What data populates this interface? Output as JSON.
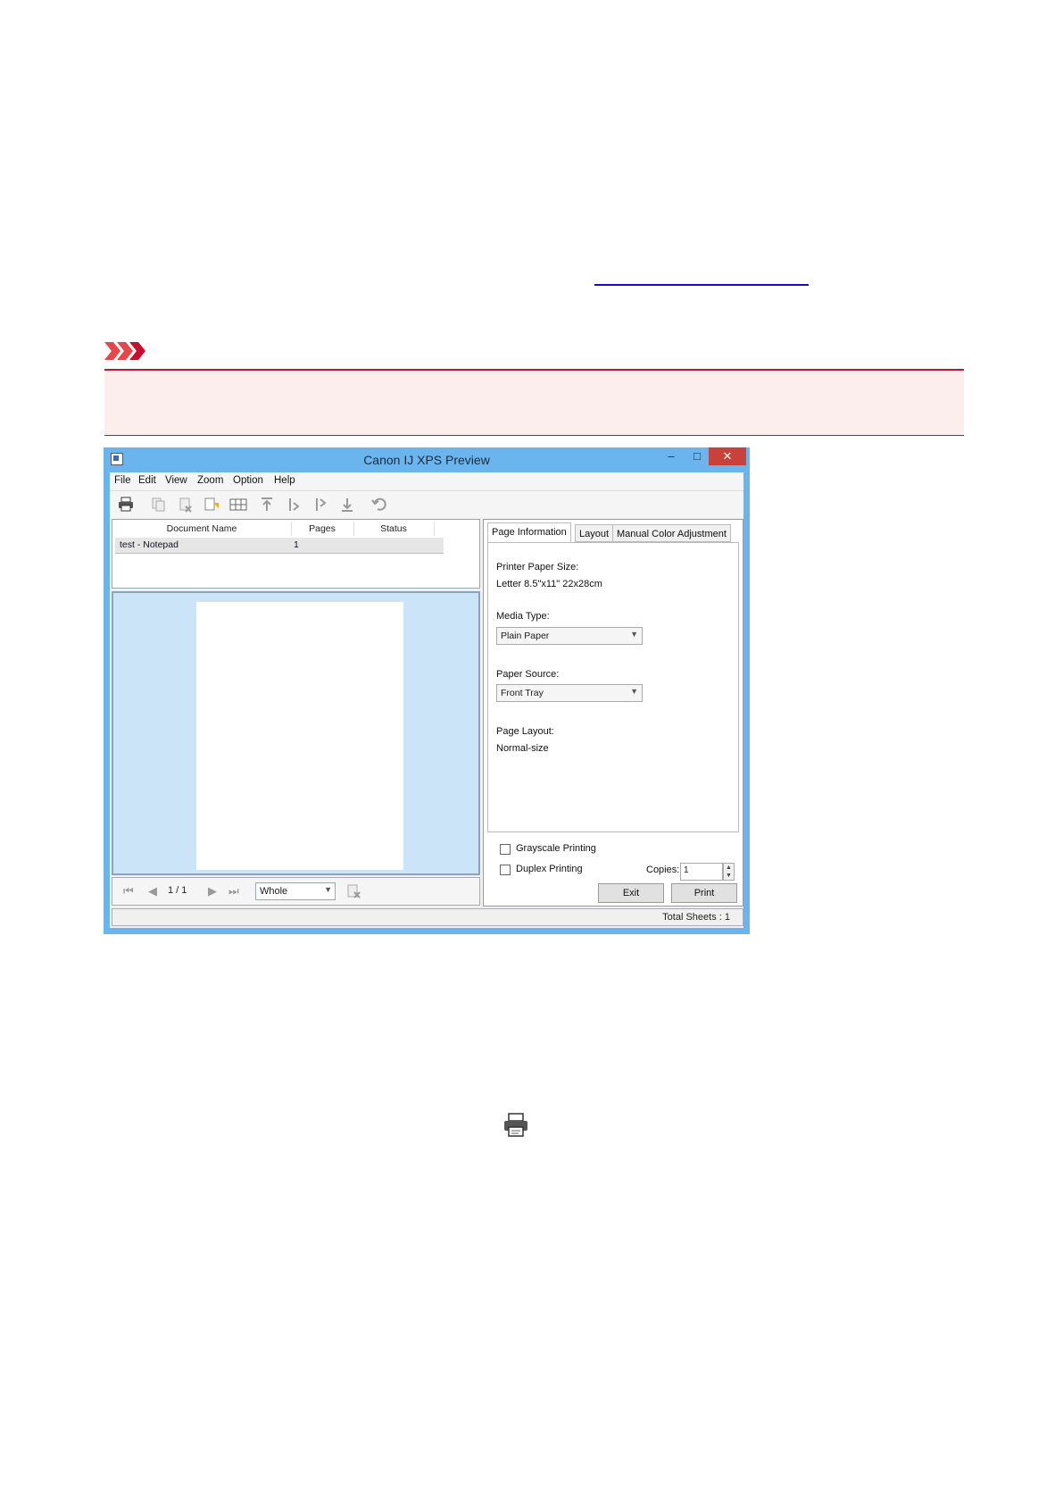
{
  "window": {
    "title": "Canon IJ XPS Preview",
    "controls": {
      "minimize": "–",
      "maximize": "□",
      "close": "✕"
    }
  },
  "menu": [
    "File",
    "Edit",
    "View",
    "Zoom",
    "Option",
    "Help"
  ],
  "toolbar_icons": [
    "printer-icon",
    "copy-icon",
    "delete-icon",
    "combine-icon",
    "multi-page-icon",
    "move-first-icon",
    "move-down-icon",
    "move-up-icon",
    "move-last-icon",
    "undo-icon"
  ],
  "doclist": {
    "headers": {
      "name": "Document Name",
      "pages": "Pages",
      "status": "Status"
    },
    "rows": [
      {
        "name": "test - Notepad",
        "pages": "1",
        "status": ""
      }
    ]
  },
  "navigation": {
    "page": "1 / 1",
    "zoom": "Whole"
  },
  "tabs": [
    "Page Information",
    "Layout",
    "Manual Color Adjustment"
  ],
  "page_info": {
    "paper_size_label": "Printer Paper Size:",
    "paper_size_value": "Letter 8.5\"x11\" 22x28cm",
    "media_type_label": "Media Type:",
    "media_type_value": "Plain Paper",
    "paper_source_label": "Paper Source:",
    "paper_source_value": "Front Tray",
    "page_layout_label": "Page Layout:",
    "page_layout_value": "Normal-size"
  },
  "options": {
    "grayscale": "Grayscale Printing",
    "duplex": "Duplex Printing",
    "copies_label": "Copies:",
    "copies_value": "1"
  },
  "buttons": {
    "exit": "Exit",
    "print": "Print"
  },
  "status": {
    "total_sheets": "Total Sheets :  1"
  },
  "colors": {
    "window_frame": "#6bb5ee",
    "close_button": "#c8413b",
    "important_red": "#c8102e",
    "preview_bg": "#cce4f7"
  }
}
